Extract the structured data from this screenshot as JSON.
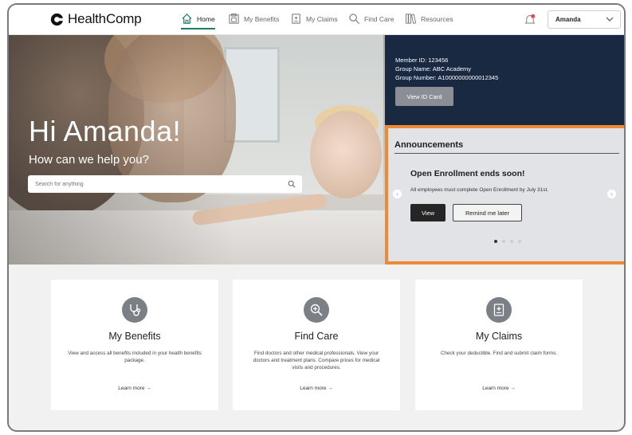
{
  "nav": {
    "logo": "HealthComp",
    "items": [
      {
        "label": "Home",
        "icon": "home-icon"
      },
      {
        "label": "My Benefits",
        "icon": "benefits-icon"
      },
      {
        "label": "My Claims",
        "icon": "claims-icon"
      },
      {
        "label": "Find Care",
        "icon": "search-icon"
      },
      {
        "label": "Resources",
        "icon": "books-icon"
      }
    ],
    "notification_count": "5",
    "user": "Amanda"
  },
  "hero": {
    "greeting": "Hi Amanda!",
    "subtitle": "How can we help you?",
    "search_placeholder": "Search for anything"
  },
  "member": {
    "id_line": "Member ID: 123456",
    "group_name_line": "Group Name: ABC Academy",
    "group_number_line": "Group Number: A10000000000012345",
    "view_id_label": "View ID Card"
  },
  "announcements": {
    "heading": "Announcements",
    "title": "Open Enrollment ends soon!",
    "message": "All employees must complete Open Enrollment by July 31st.",
    "view_label": "View",
    "remind_label": "Remind me later"
  },
  "cards": [
    {
      "title": "My Benefits",
      "description": "View and access all benefits included in your health benefits package.",
      "link": "Learn more →",
      "icon": "stethoscope-icon"
    },
    {
      "title": "Find Care",
      "description": "Find doctors and other medical professionals. View your doctors and treatment plans. Compare prices for medical visits and procedures.",
      "link": "Learn more →",
      "icon": "search-plus-icon"
    },
    {
      "title": "My Claims",
      "description": "Check your deductible. Find and submit claim forms.",
      "link": "Learn more →",
      "icon": "clipboard-plus-icon"
    }
  ],
  "colors": {
    "accent": "#1d7d6d",
    "member_bg": "#182941",
    "highlight_border": "#ec8a38"
  }
}
